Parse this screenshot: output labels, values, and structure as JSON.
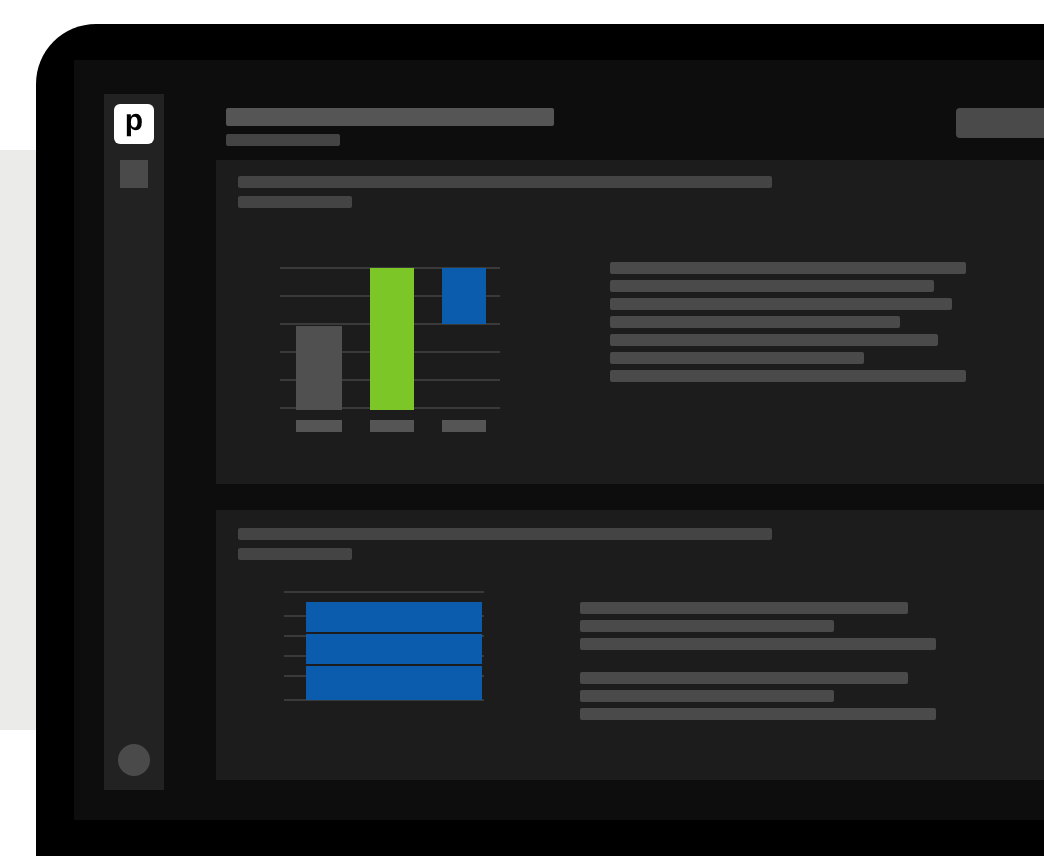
{
  "sidebar": {
    "logo": "p"
  }
}
